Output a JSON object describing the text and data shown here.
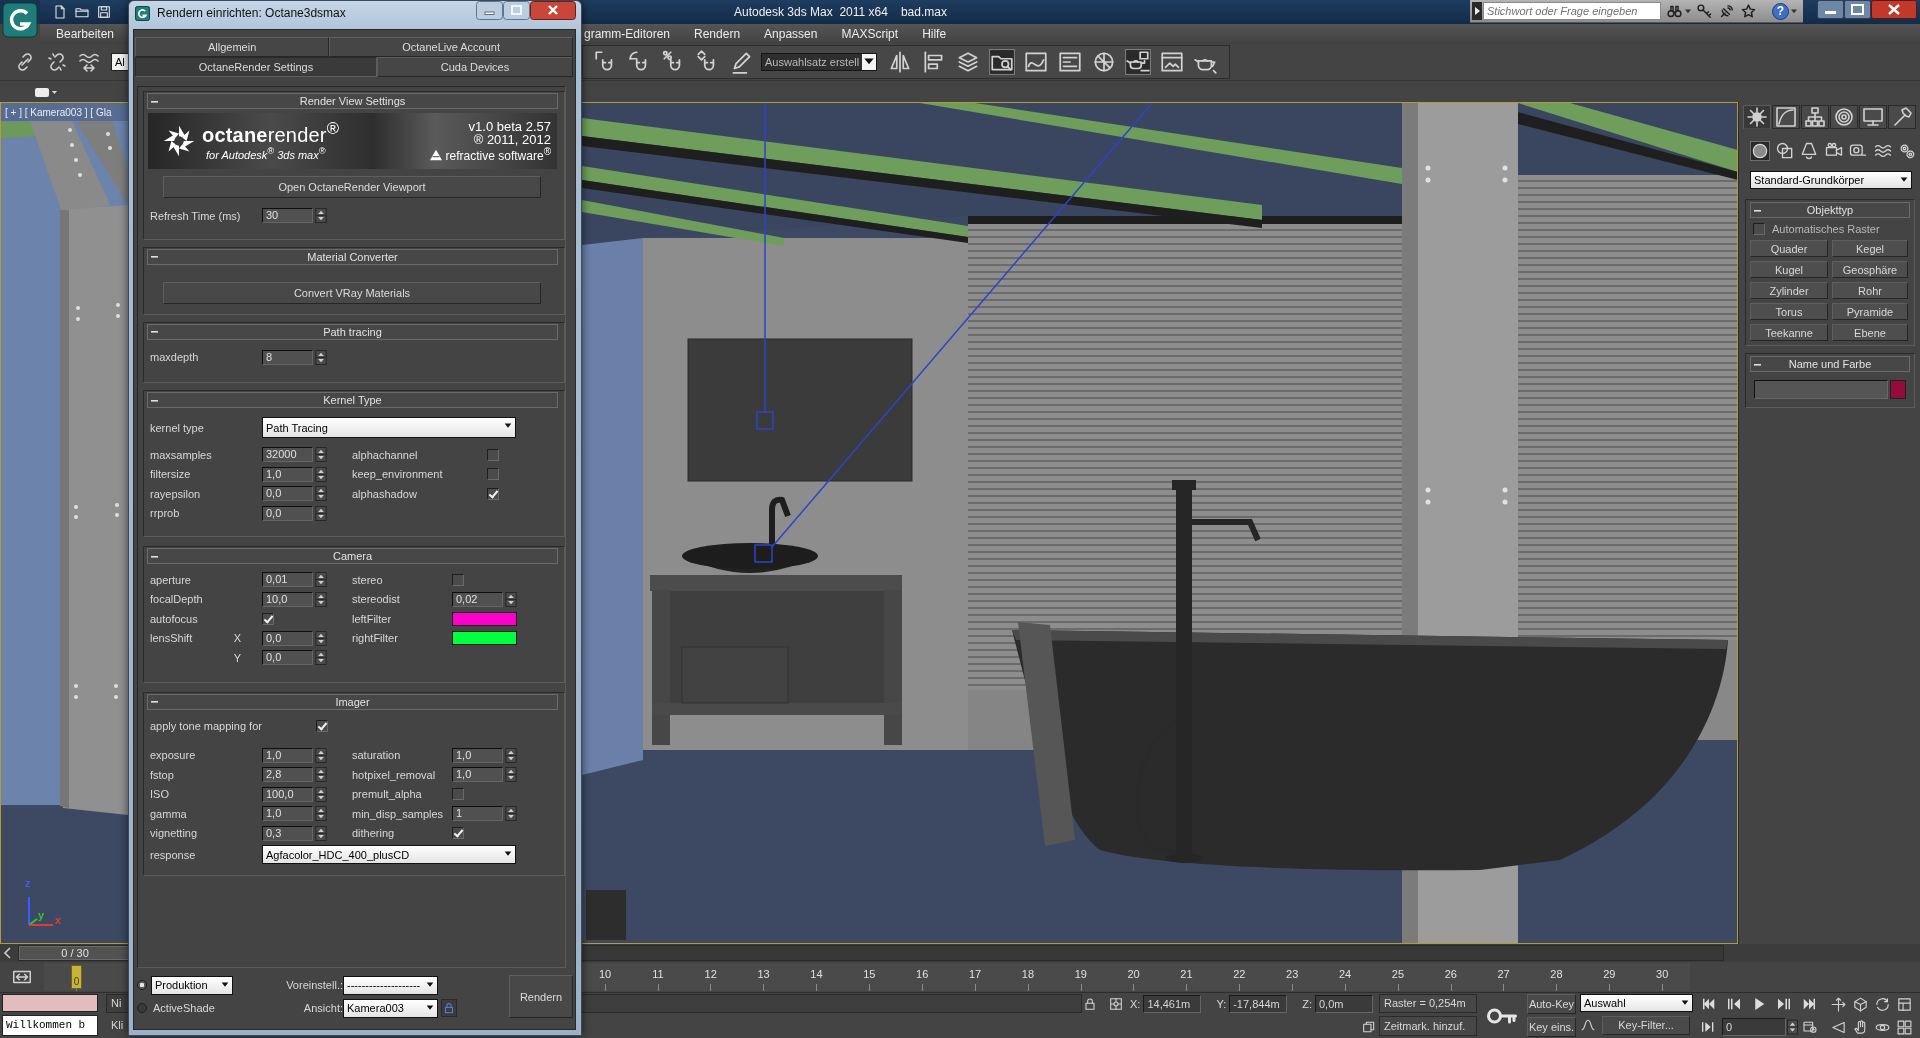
{
  "app": {
    "title": "Autodesk 3ds Max  2011 x64",
    "file_name": "bad.max",
    "help_label": "?"
  },
  "search": {
    "placeholder": "Stichwort oder Frage eingeben"
  },
  "menu_bar": [
    {
      "label": "Bearbeiten"
    },
    {
      "label": "gramm-Editoren"
    },
    {
      "label": "Rendern"
    },
    {
      "label": "Anpassen"
    },
    {
      "label": "MAXScript"
    },
    {
      "label": "Hilfe"
    }
  ],
  "main_toolbar": {
    "selection_filter": "Al",
    "named_selection": "Auswahlsatz erstell",
    "buttons": [
      {
        "pressed": false
      },
      {
        "pressed": false
      },
      {
        "pressed": false
      },
      {
        "pressed": false
      },
      {
        "pressed": false
      },
      {
        "pressed": false
      },
      {
        "pressed": false
      },
      {
        "pressed": false
      },
      {
        "pressed": true
      },
      {
        "pressed": false
      },
      {
        "pressed": false
      },
      {
        "pressed": false
      },
      {
        "pressed": true
      },
      {
        "pressed": false
      },
      {
        "pressed": false
      }
    ]
  },
  "viewport": {
    "label": "[ + ] [ Kamera003 ] [ Gla",
    "axes": [
      {
        "label": "z",
        "color": "#3c5cff"
      },
      {
        "label": "y",
        "color": "#2fc52f"
      },
      {
        "label": "x",
        "color": "#e03a3a"
      }
    ]
  },
  "command_panel": {
    "tabs": [
      {
        "selected": true
      },
      {
        "selected": false
      },
      {
        "selected": false
      },
      {
        "selected": false
      },
      {
        "selected": false
      },
      {
        "selected": false
      }
    ],
    "categories": [
      {
        "selected": true
      },
      {
        "selected": false
      },
      {
        "selected": false
      },
      {
        "selected": false
      },
      {
        "selected": false
      },
      {
        "selected": false
      },
      {
        "selected": false
      }
    ],
    "object_category": "Standard-Grundkörper",
    "rollouts": [
      {
        "kind": "object_type",
        "title": "Objekttyp",
        "expanded": true,
        "auto_grid": {
          "label": "Automatisches Raster",
          "checked": false
        },
        "buttons": [
          "Quader",
          "Kegel",
          "Kugel",
          "Geosphäre",
          "Zylinder",
          "Rohr",
          "Torus",
          "Pyramide",
          "Teekanne",
          "Ebene"
        ]
      },
      {
        "kind": "name_color",
        "title": "Name und Farbe",
        "expanded": true,
        "color": "#930c3b"
      }
    ]
  },
  "time_slider": {
    "label": "0 / 30",
    "level": 0
  },
  "track_bar": {
    "current_frame_label": "0",
    "frame_labels": [
      "10",
      "11",
      "12",
      "13",
      "14",
      "15",
      "16",
      "17",
      "18",
      "19",
      "20",
      "21",
      "22",
      "23",
      "24",
      "25",
      "26",
      "27",
      "28",
      "29",
      "30"
    ]
  },
  "status_bar": {
    "listener_output": "Willkommen b",
    "prompt_lines": [
      "Ni",
      "Kli"
    ],
    "coordinates": [
      {
        "axis": "X:",
        "value": "14,461m"
      },
      {
        "axis": "Y:",
        "value": "-17,844m"
      },
      {
        "axis": "Z:",
        "value": "0,0m"
      }
    ],
    "grid": "Raster = 0,254m",
    "add_time_tag": "Zeitmark. hinzuf.",
    "auto_key": "Auto-Key",
    "set_key": "Key eins.",
    "key_set": "Auswahl",
    "key_filters": "Key-Filter...",
    "current_frame": "0"
  },
  "render_setup": {
    "title": "Rendern einrichten: Octane3dsmax",
    "tab_rows": [
      {
        "tabs": [
          {
            "label": "Allgemein",
            "selected": false
          },
          {
            "label": "OctaneLive Account",
            "selected": false
          }
        ]
      },
      {
        "tabs": [
          {
            "label": "OctaneRender Settings",
            "selected": true
          },
          {
            "label": "Cuda Devices",
            "selected": false
          }
        ]
      }
    ],
    "rollouts": [
      {
        "kind": "render_view",
        "title": "Render View Settings",
        "expanded": true,
        "banner": {
          "product": "**octane**render$^{®}$",
          "subtitle": "for Autodesk$^{®}$ 3ds max$^{®}$",
          "version": "v1.0 beta 2.57",
          "copyright": "® 2011, 2012",
          "vendor": "refractive software$^{®}$"
        },
        "rows": [
          {
            "kind": "button",
            "label": "Open OctaneRender Viewport"
          },
          {
            "kind": "fields",
            "cells": [
              {
                "kind": "spinner",
                "label": "Refresh Time (ms)",
                "value": "30"
              }
            ]
          }
        ]
      },
      {
        "kind": "material",
        "title": "Material Converter",
        "expanded": true,
        "rows": [
          {
            "kind": "button",
            "label": "Convert VRay Materials"
          }
        ]
      },
      {
        "kind": "path",
        "title": "Path tracing",
        "expanded": true,
        "rows": [
          {
            "kind": "fields",
            "cells": [
              {
                "kind": "spinner",
                "label": "maxdepth",
                "value": "8"
              }
            ]
          }
        ]
      },
      {
        "kind": "kernel",
        "title": "Kernel Type",
        "expanded": true,
        "rows": [
          {
            "kind": "dropdown",
            "label": "kernel type",
            "value": "Path Tracing"
          },
          {
            "kind": "fields",
            "cells": [
              {
                "kind": "spinner",
                "label": "maxsamples",
                "value": "32000"
              },
              {
                "kind": "checkbox",
                "label": "alphachannel",
                "checked": false
              }
            ]
          },
          {
            "kind": "fields",
            "cells": [
              {
                "kind": "spinner",
                "label": "filtersize",
                "value": "1,0"
              },
              {
                "kind": "checkbox",
                "label": "keep_environment",
                "checked": false
              }
            ]
          },
          {
            "kind": "fields",
            "cells": [
              {
                "kind": "spinner",
                "label": "rayepsilon",
                "value": "0,0"
              },
              {
                "kind": "checkbox",
                "label": "alphashadow",
                "checked": true
              }
            ]
          },
          {
            "kind": "fields",
            "cells": [
              {
                "kind": "spinner",
                "label": "rrprob",
                "value": "0,0"
              }
            ]
          }
        ]
      },
      {
        "kind": "camera",
        "title": "Camera",
        "expanded": true,
        "rows": [
          {
            "kind": "fields",
            "cells": [
              {
                "kind": "spinner",
                "label": "aperture",
                "value": "0,01"
              },
              {
                "kind": "checkbox",
                "label": "stereo",
                "checked": false
              }
            ]
          },
          {
            "kind": "fields",
            "cells": [
              {
                "kind": "spinner",
                "label": "focalDepth",
                "value": "10,0"
              },
              {
                "kind": "spinner",
                "label": "stereodist",
                "value": "0,02"
              }
            ]
          },
          {
            "kind": "fields",
            "cells": [
              {
                "kind": "checkbox",
                "label": "autofocus",
                "checked": true
              },
              {
                "kind": "swatch",
                "label": "leftFilter",
                "color": "#ff00cc"
              }
            ]
          },
          {
            "kind": "fields",
            "cells": [
              {
                "kind": "spinner",
                "label": "lensShift",
                "axis": "X",
                "value": "0,0"
              },
              {
                "kind": "swatch",
                "label": "rightFilter",
                "color": "#00ff40"
              }
            ]
          },
          {
            "kind": "fields",
            "cells": [
              {
                "kind": "spinner",
                "axis": "Y",
                "value": "0,0"
              }
            ]
          }
        ]
      },
      {
        "kind": "imager",
        "title": "Imager",
        "expanded": true,
        "rows": [
          {
            "kind": "check",
            "label": "apply tone mapping for",
            "checked": true
          },
          {
            "kind": "fields",
            "cells": [
              {
                "kind": "spinner",
                "label": "exposure",
                "value": "1,0"
              },
              {
                "kind": "spinner",
                "label": "saturation",
                "value": "1,0"
              }
            ]
          },
          {
            "kind": "fields",
            "cells": [
              {
                "kind": "spinner",
                "label": "fstop",
                "value": "2,8"
              },
              {
                "kind": "spinner",
                "label": "hotpixel_removal",
                "value": "1,0"
              }
            ]
          },
          {
            "kind": "fields",
            "cells": [
              {
                "kind": "spinner",
                "label": "ISO",
                "value": "100,0"
              },
              {
                "kind": "checkbox",
                "label": "premult_alpha",
                "checked": false
              }
            ]
          },
          {
            "kind": "fields",
            "cells": [
              {
                "kind": "spinner",
                "label": "gamma",
                "value": "1,0"
              },
              {
                "kind": "spinner",
                "label": "min_disp_samples",
                "value": "1"
              }
            ]
          },
          {
            "kind": "fields",
            "cells": [
              {
                "kind": "spinner",
                "label": "vignetting",
                "value": "0,3"
              },
              {
                "kind": "checkbox",
                "label": "dithering",
                "checked": true
              }
            ]
          },
          {
            "kind": "dropdown",
            "label": "response",
            "value": "Agfacolor_HDC_400_plusCD"
          }
        ]
      }
    ],
    "render_modes": [
      {
        "kind": "dropdown",
        "value": "Produktion",
        "selected": true
      },
      {
        "kind": "label",
        "label": "ActiveShade",
        "selected": false
      }
    ],
    "preset": {
      "label": "Voreinstell.:",
      "value": "--------------------"
    },
    "view": {
      "label": "Ansicht:",
      "value": "Kamera003"
    },
    "render_button": "Rendern"
  }
}
